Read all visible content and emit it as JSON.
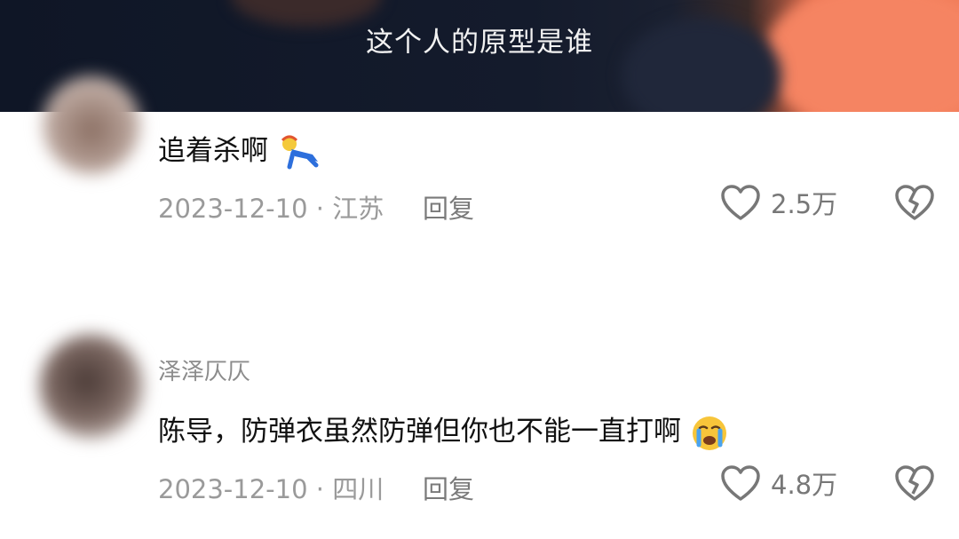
{
  "video": {
    "subtitle": "这个人的原型是谁"
  },
  "comments": [
    {
      "username": "",
      "text": "追着杀啊",
      "emoji": "sticker-running-figure-icon",
      "date": "2023-12-10",
      "location": "江苏",
      "separator": "·",
      "reply_label": "回复",
      "likes": "2.5万"
    },
    {
      "username": "泽泽仄仄",
      "text": "陈导，防弹衣虽然防弹但你也不能一直打啊",
      "emoji": "crying-face-icon",
      "date": "2023-12-10",
      "location": "四川",
      "separator": "·",
      "reply_label": "回复",
      "likes": "4.8万"
    }
  ],
  "icons": {
    "like": "heart-outline-icon",
    "dislike": "broken-heart-icon"
  },
  "colors": {
    "text_primary": "#111111",
    "text_secondary": "#9a9a9a",
    "icon_gray": "#777777"
  }
}
